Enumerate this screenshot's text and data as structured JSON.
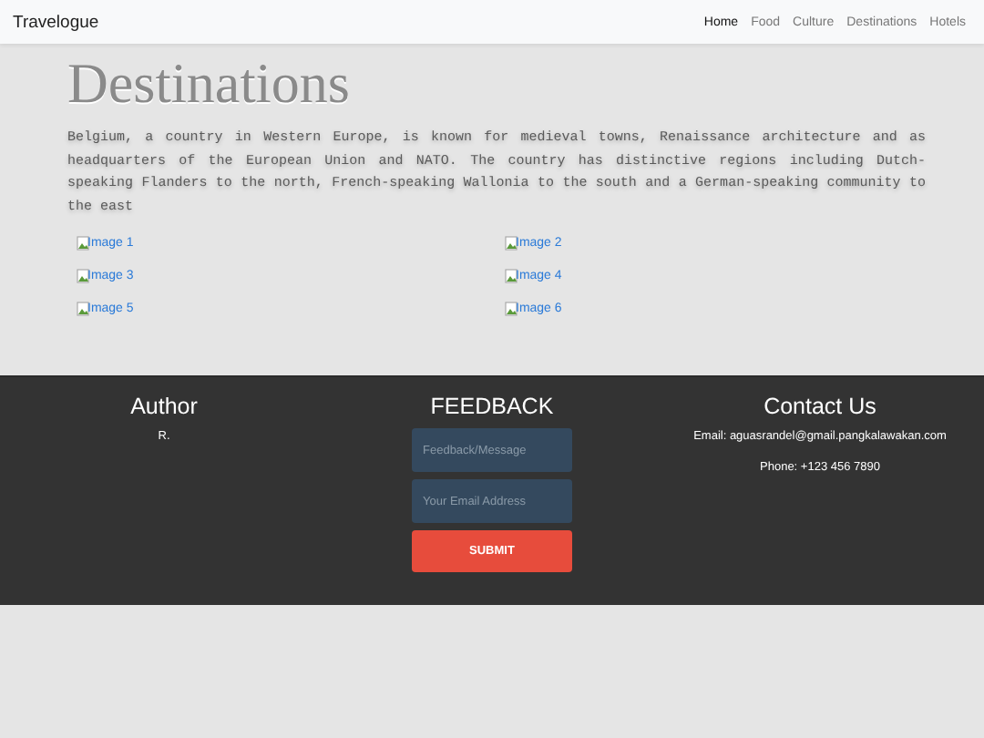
{
  "navbar": {
    "brand": "Travelogue",
    "links": [
      {
        "label": "Home",
        "selected": true
      },
      {
        "label": "Food",
        "selected": false
      },
      {
        "label": "Culture",
        "selected": false
      },
      {
        "label": "Destinations",
        "selected": false
      },
      {
        "label": "Hotels",
        "selected": false
      }
    ]
  },
  "hero": {
    "title": "Destinations",
    "text": "Belgium, a country in Western Europe, is known for medieval towns, Renaissance architecture and as headquarters of the European Union and NATO. The country has distinctive regions including Dutch-speaking Flanders to the north, French-speaking Wallonia to the south and a German-speaking community to the east"
  },
  "gallery": [
    "Image 1",
    "Image 2",
    "Image 3",
    "Image 4",
    "Image 5",
    "Image 6"
  ],
  "footer": {
    "author": {
      "heading": "Author",
      "name": "R."
    },
    "feedback": {
      "heading": "FEEDBACK",
      "message_placeholder": "Feedback/Message",
      "email_placeholder": "Your Email Address",
      "submit": "SUBMIT"
    },
    "contact": {
      "heading": "Contact Us",
      "email": "Email: aguasrandel@gmail.pangkalawakan.com",
      "phone": "Phone: +123 456 7890"
    }
  }
}
